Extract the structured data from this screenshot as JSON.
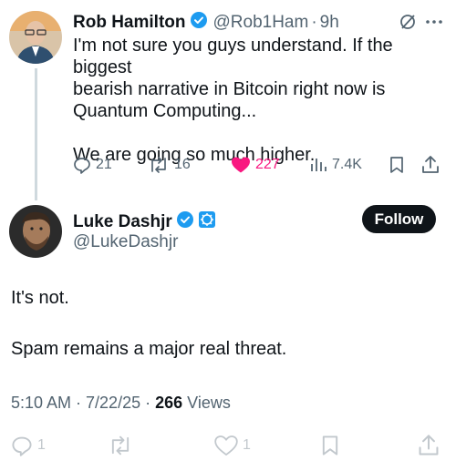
{
  "tweet1": {
    "name": "Rob Hamilton",
    "handle": "@Rob1Ham",
    "time": "9h",
    "text_lines": [
      "I'm not sure you guys understand. If the biggest",
      "bearish narrative in Bitcoin right now is",
      "Quantum Computing...",
      "We are going so much higher."
    ],
    "replies": "21",
    "reposts": "16",
    "likes": "227",
    "views": "7.4K"
  },
  "tweet2": {
    "name": "Luke Dashjr",
    "handle": "@LukeDashjr",
    "follow_label": "Follow",
    "body_lines": [
      "It's not.",
      "Spam remains a major real threat."
    ],
    "time": "5:10 AM · 7/22/25 ·",
    "views_count": "266",
    "views_label": "Views",
    "replies": "1",
    "likes": "1"
  },
  "colors": {
    "verified_blue": "#1d9bf0",
    "like_pink": "#f91880",
    "secondary_text": "#536471"
  }
}
